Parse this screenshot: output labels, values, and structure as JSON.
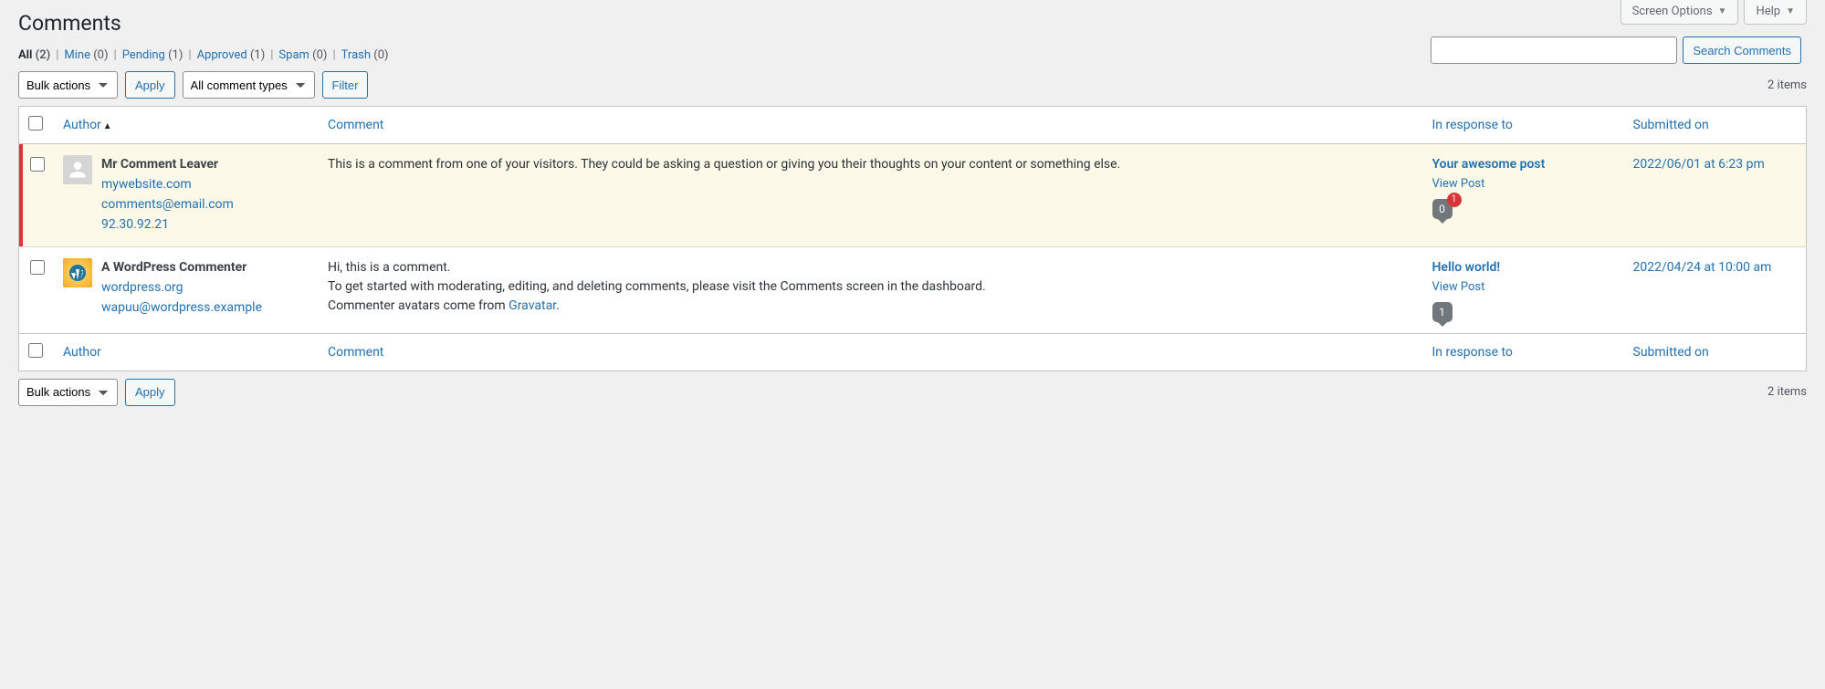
{
  "top_tabs": {
    "screen_options": "Screen Options",
    "help": "Help"
  },
  "page_title": "Comments",
  "filters": {
    "all": {
      "label": "All",
      "count": "(2)"
    },
    "mine": {
      "label": "Mine",
      "count": "(0)"
    },
    "pending": {
      "label": "Pending",
      "count": "(1)"
    },
    "approved": {
      "label": "Approved",
      "count": "(1)"
    },
    "spam": {
      "label": "Spam",
      "count": "(0)"
    },
    "trash": {
      "label": "Trash",
      "count": "(0)"
    }
  },
  "search": {
    "value": "",
    "button": "Search Comments"
  },
  "bulk_actions": {
    "select_label": "Bulk actions",
    "apply": "Apply"
  },
  "comment_types": {
    "select_label": "All comment types",
    "filter": "Filter"
  },
  "items_count": "2 items",
  "columns": {
    "author": "Author",
    "comment": "Comment",
    "response": "In response to",
    "date": "Submitted on"
  },
  "rows": [
    {
      "status": "unapproved",
      "author_name": "Mr Comment Leaver",
      "author_url": "mywebsite.com",
      "author_email": "comments@email.com",
      "author_ip": "92.30.92.21",
      "comment_html": "This is a comment from one of your visitors. They could be asking a question or giving you their thoughts on your content or something else.",
      "post_title": "Your awesome post",
      "view_post": "View Post",
      "bubble": "0",
      "pending_badge": "1",
      "date": "2022/06/01 at 6:23 pm"
    },
    {
      "status": "approved",
      "author_name": "A WordPress Commenter",
      "author_url": "wordpress.org",
      "author_email": "wapuu@wordpress.example",
      "author_ip": "",
      "comment_html": "Hi, this is a comment.<br>To get started with moderating, editing, and deleting comments, please visit the Comments screen in the dashboard.<br>Commenter avatars come from <a href='#'>Gravatar</a>.",
      "post_title": "Hello world!",
      "view_post": "View Post",
      "bubble": "1",
      "pending_badge": "",
      "date": "2022/04/24 at 10:00 am"
    }
  ],
  "colors": {
    "link": "#2271b1",
    "unapproved_bg": "#fcf9e8",
    "unapproved_stripe": "#d63638"
  }
}
